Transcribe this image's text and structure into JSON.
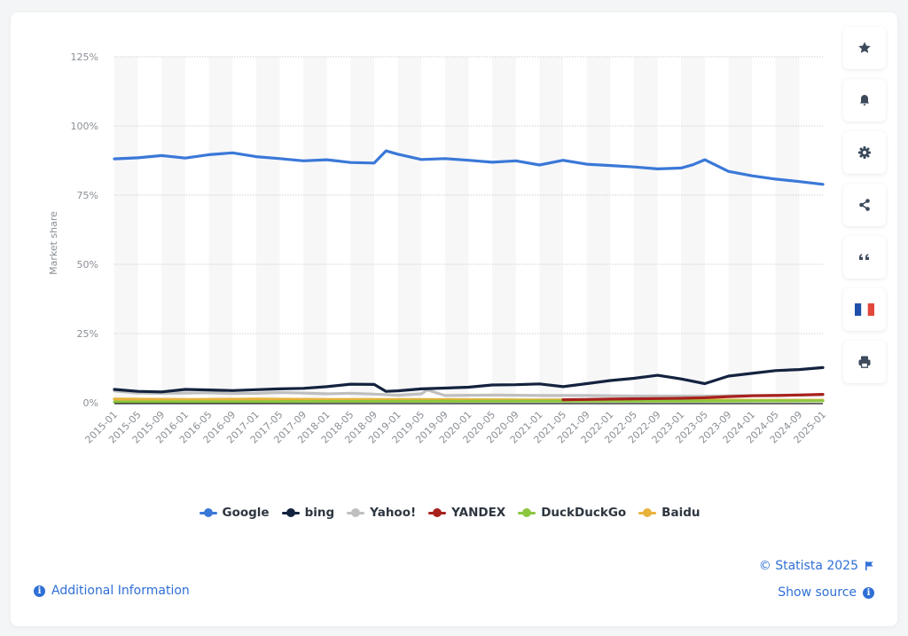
{
  "chart_data": {
    "type": "line",
    "title": "",
    "xlabel": "",
    "ylabel": "Market share",
    "ylim": [
      0,
      125
    ],
    "yticks": [
      "0%",
      "25%",
      "50%",
      "75%",
      "100%",
      "125%"
    ],
    "ytick_values": [
      0,
      25,
      50,
      75,
      100,
      125
    ],
    "grid": true,
    "legend_position": "bottom",
    "x_range": [
      "2015-01",
      "2025-01"
    ],
    "xtick_labels": [
      "2015-01",
      "2015-05",
      "2015-09",
      "2016-01",
      "2016-05",
      "2016-09",
      "2017-01",
      "2017-05",
      "2017-09",
      "2018-01",
      "2018-05",
      "2018-09",
      "2019-01",
      "2019-05",
      "2019-09",
      "2020-01",
      "2020-05",
      "2020-09",
      "2021-01",
      "2021-05",
      "2021-09",
      "2022-01",
      "2022-05",
      "2022-09",
      "2023-01",
      "2023-05",
      "2023-09",
      "2024-01",
      "2024-05",
      "2024-09",
      "2025-01"
    ],
    "series": [
      {
        "name": "Google",
        "color": "#3a78d8",
        "x": [
          "2015-01",
          "2015-05",
          "2015-09",
          "2016-01",
          "2016-05",
          "2016-09",
          "2017-01",
          "2017-05",
          "2017-09",
          "2018-01",
          "2018-05",
          "2018-09",
          "2018-11",
          "2019-01",
          "2019-05",
          "2019-09",
          "2020-01",
          "2020-05",
          "2020-09",
          "2021-01",
          "2021-05",
          "2021-09",
          "2022-01",
          "2022-05",
          "2022-09",
          "2023-01",
          "2023-03",
          "2023-05",
          "2023-09",
          "2024-01",
          "2024-05",
          "2024-09",
          "2025-01"
        ],
        "values": [
          88.1,
          88.5,
          89.3,
          88.4,
          89.6,
          90.3,
          88.9,
          88.2,
          87.4,
          87.8,
          86.8,
          86.6,
          91.0,
          89.8,
          87.9,
          88.2,
          87.6,
          86.9,
          87.4,
          85.9,
          87.6,
          86.2,
          85.7,
          85.2,
          84.5,
          84.8,
          86.0,
          87.8,
          83.6,
          82.0,
          80.8,
          79.9,
          78.9
        ]
      },
      {
        "name": "bing",
        "color": "#13233f",
        "x": [
          "2015-01",
          "2015-05",
          "2015-09",
          "2016-01",
          "2016-05",
          "2016-09",
          "2017-01",
          "2017-05",
          "2017-09",
          "2018-01",
          "2018-05",
          "2018-09",
          "2018-11",
          "2019-01",
          "2019-05",
          "2019-09",
          "2020-01",
          "2020-05",
          "2020-09",
          "2021-01",
          "2021-05",
          "2021-09",
          "2022-01",
          "2022-05",
          "2022-09",
          "2023-01",
          "2023-05",
          "2023-09",
          "2024-01",
          "2024-05",
          "2024-09",
          "2025-01"
        ],
        "values": [
          4.8,
          4.1,
          3.9,
          4.8,
          4.6,
          4.4,
          4.7,
          5.0,
          5.2,
          5.8,
          6.7,
          6.6,
          4.1,
          4.3,
          5.0,
          5.3,
          5.6,
          6.4,
          6.5,
          6.8,
          5.8,
          6.9,
          8.0,
          8.8,
          9.9,
          8.6,
          6.9,
          9.6,
          10.6,
          11.6,
          12.0,
          12.7
        ]
      },
      {
        "name": "Yahoo!",
        "color": "#bfbfbf",
        "x": [
          "2015-01",
          "2015-05",
          "2015-09",
          "2016-01",
          "2016-05",
          "2016-09",
          "2017-01",
          "2017-05",
          "2017-09",
          "2018-01",
          "2018-05",
          "2018-09",
          "2019-01",
          "2019-05",
          "2019-06",
          "2019-09",
          "2020-01",
          "2020-05",
          "2020-09",
          "2021-01",
          "2021-05",
          "2021-09",
          "2022-01",
          "2022-05",
          "2022-09",
          "2023-01",
          "2023-05",
          "2023-09",
          "2024-01",
          "2024-05",
          "2024-09",
          "2025-01"
        ],
        "values": [
          4.3,
          3.5,
          3.4,
          3.5,
          3.6,
          3.3,
          3.4,
          3.7,
          3.5,
          3.2,
          3.4,
          3.1,
          2.7,
          3.2,
          4.6,
          2.6,
          2.7,
          2.8,
          2.7,
          2.6,
          2.6,
          2.6,
          2.5,
          2.4,
          2.4,
          2.4,
          2.4,
          2.5,
          2.6,
          2.7,
          2.8,
          2.9
        ]
      },
      {
        "name": "YANDEX",
        "color": "#a8211d",
        "x": [
          "2021-05",
          "2021-09",
          "2022-01",
          "2022-05",
          "2022-09",
          "2023-01",
          "2023-05",
          "2023-09",
          "2024-01",
          "2024-05",
          "2024-09",
          "2025-01"
        ],
        "values": [
          1.1,
          1.2,
          1.3,
          1.4,
          1.5,
          1.6,
          1.8,
          2.2,
          2.5,
          2.6,
          2.8,
          3.0
        ]
      },
      {
        "name": "DuckDuckGo",
        "color": "#8cc63f",
        "x": [
          "2015-01",
          "2017-01",
          "2019-01",
          "2021-01",
          "2023-01",
          "2025-01"
        ],
        "values": [
          0.3,
          0.4,
          0.5,
          0.6,
          0.6,
          0.7
        ]
      },
      {
        "name": "Baidu",
        "color": "#e8b33c",
        "x": [
          "2015-01",
          "2016-01",
          "2017-01",
          "2018-01",
          "2019-01",
          "2020-01",
          "2021-01",
          "2022-01",
          "2023-01",
          "2024-01",
          "2025-01"
        ],
        "values": [
          1.3,
          1.2,
          1.3,
          1.2,
          1.2,
          1.1,
          1.0,
          1.0,
          1.0,
          0.9,
          0.9
        ]
      }
    ]
  },
  "side_toolbar": [
    {
      "name": "favorite",
      "icon": "star-icon"
    },
    {
      "name": "notifications",
      "icon": "bell-icon"
    },
    {
      "name": "settings",
      "icon": "gear-icon"
    },
    {
      "name": "share",
      "icon": "share-icon"
    },
    {
      "name": "cite",
      "icon": "quote-icon"
    },
    {
      "name": "language",
      "icon": "french-flag-icon"
    },
    {
      "name": "print",
      "icon": "printer-icon"
    }
  ],
  "footer": {
    "additional_info": "Additional Information",
    "copyright": "© Statista 2025",
    "show_source": "Show source",
    "link_color": "#2f6fd6"
  }
}
